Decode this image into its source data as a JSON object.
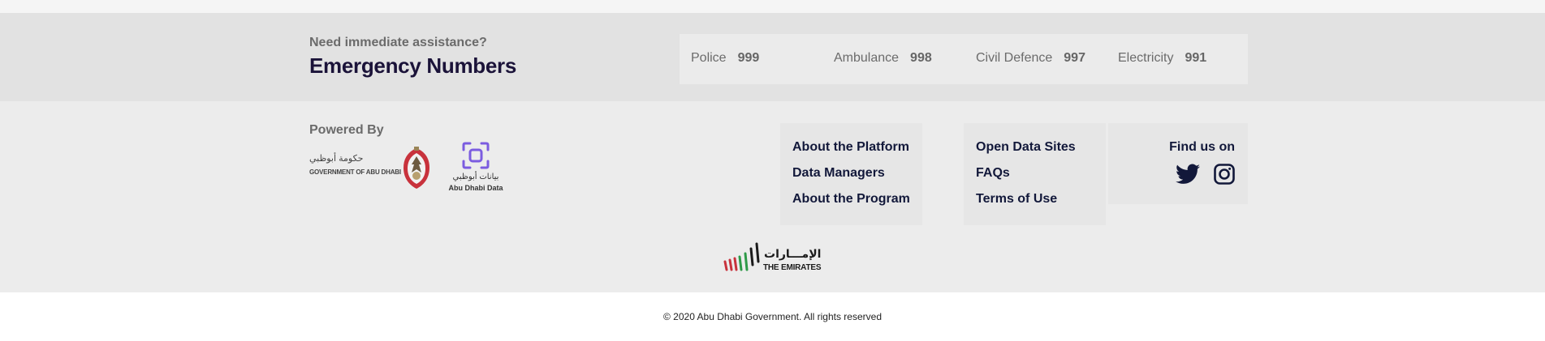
{
  "emergency": {
    "subtitle": "Need immediate assistance?",
    "title": "Emergency Numbers",
    "numbers": [
      {
        "label": "Police",
        "value": "999"
      },
      {
        "label": "Ambulance",
        "value": "998"
      },
      {
        "label": "Civil Defence",
        "value": "997"
      },
      {
        "label": "Electricity",
        "value": "991"
      }
    ]
  },
  "footer": {
    "powered_by": "Powered By",
    "gov_logo": {
      "arabic": "حكومة أبوظبي",
      "english": "GOVERNMENT OF ABU DHABI"
    },
    "data_logo": {
      "arabic": "بيانات أبوظبي",
      "english": "Abu Dhabi Data"
    },
    "links_col1": [
      "About the Platform",
      "Data Managers",
      "About the Program"
    ],
    "links_col2": [
      "Open Data Sites",
      "FAQs",
      "Terms of Use"
    ],
    "find_us": "Find us on",
    "social_icons": [
      "twitter-icon",
      "instagram-icon"
    ],
    "emirates_logo": {
      "arabic": "الإمـــارات",
      "english": "THE EMIRATES"
    }
  },
  "copyright": "© 2020 Abu Dhabi Government. All rights reserved",
  "colors": {
    "navy": "#12183a",
    "purple": "#7b5ce0",
    "gray_text": "#6b6b6b"
  }
}
